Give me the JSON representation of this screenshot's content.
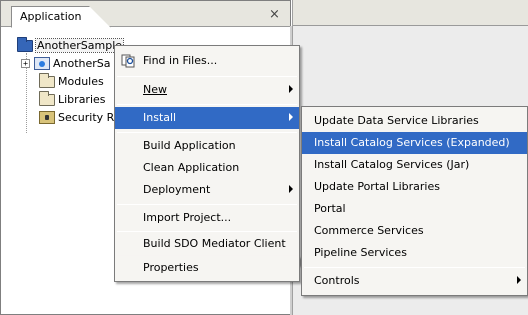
{
  "panel": {
    "tab_label": "Application",
    "close_symbol": "×"
  },
  "tree": {
    "root": "AnotherSample",
    "children": [
      {
        "label": "AnotherSa",
        "icon": "project-icon",
        "expander": "+"
      },
      {
        "label": "Modules",
        "icon": "folder-icon"
      },
      {
        "label": "Libraries",
        "icon": "folder-icon"
      },
      {
        "label": "Security Ro",
        "icon": "security-role-icon"
      }
    ]
  },
  "context_menu": {
    "find_in_files": "Find in Files...",
    "new": "New",
    "install": "Install",
    "build_application": "Build Application",
    "clean_application": "Clean Application",
    "deployment": "Deployment",
    "import_project": "Import Project...",
    "build_sdo": "Build SDO Mediator Client",
    "properties": "Properties"
  },
  "install_submenu": {
    "items": [
      "Update Data Service Libraries",
      "Install Catalog Services (Expanded)",
      "Install Catalog Services (Jar)",
      "Update Portal Libraries",
      "Portal",
      "Commerce Services",
      "Pipeline Services",
      "Controls"
    ]
  },
  "colors": {
    "highlight": "#316ac5",
    "menu_bg": "#f6f5f2",
    "tab_bg": "#e7e6df"
  }
}
